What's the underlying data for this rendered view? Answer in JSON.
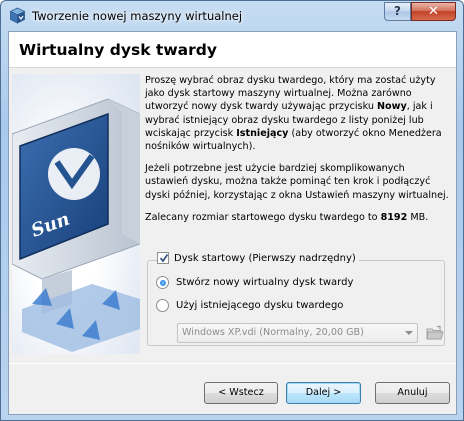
{
  "window": {
    "title": "Tworzenie nowej maszyny wirtualnej",
    "help_label": "?",
    "close_label": "✕"
  },
  "header": {
    "title": "Wirtualny dysk twardy"
  },
  "description": {
    "p1_a": "Proszę wybrać obraz dysku twardego, który ma zostać użyty jako dysk startowy maszyny wirtualnej. Można zarówno utworzyć nowy dysk twardy używając przycisku ",
    "p1_new": "Nowy",
    "p1_b": ", jak i wybrać istniejący obraz dysku twardego z listy poniżej lub wciskając przycisk ",
    "p1_existing": "Istniejący",
    "p1_c": " (aby otworzyć okno Menedżera nośników wirtualnych).",
    "p2": "Jeżeli potrzebne jest użycie bardziej skomplikowanych ustawień dysku, można także pominąć ten krok i podłączyć dyski później, korzystając z okna Ustawień maszyny wirtualnej.",
    "p3_a": "Zalecany rozmiar startowego dysku twardego to ",
    "p3_size": "8192",
    "p3_b": " MB."
  },
  "boot_disk": {
    "checkbox_label": "Dysk startowy (Pierwszy nadrzędny)",
    "checked": true,
    "option_new": "Stwórz nowy wirtualny dysk twardy",
    "option_existing": "Użyj istniejącego dysku twardego",
    "selected_option": "new",
    "existing_disk_value": "Windows XP.vdi (Normalny, 20,00 GB)"
  },
  "buttons": {
    "back": "< Wstecz",
    "next": "Dalej >",
    "cancel": "Anuluj"
  },
  "colors": {
    "titlebar": "#b9d3ef",
    "close": "#c1432a",
    "accent": "#3c7fb1"
  },
  "icons": {
    "app": "virtualbox-cube-icon",
    "folder": "open-folder-icon",
    "check": "checkmark-icon"
  }
}
